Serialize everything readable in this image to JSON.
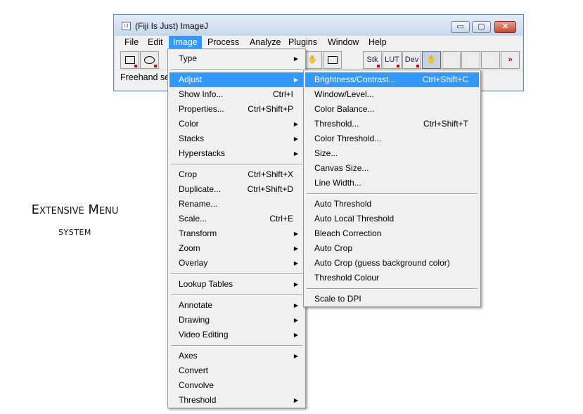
{
  "caption": {
    "line1": "Extensive Menu",
    "line2": "system"
  },
  "window": {
    "title": "(Fiji Is Just) ImageJ",
    "icon_text": "IJ",
    "controls": {
      "minimize": "▭",
      "maximize": "▢",
      "close": "✕"
    }
  },
  "menubar": [
    "File",
    "Edit",
    "Image",
    "Process",
    "Analyze",
    "Plugins",
    "Window",
    "Help"
  ],
  "toolbar": {
    "stk": "Stk",
    "lut": "LUT",
    "dev": "Dev",
    "more": "»",
    "hand": "✋"
  },
  "status": "Freehand selections",
  "image_menu": [
    {
      "label": "Type",
      "submenu": true
    },
    {
      "label": "Adjust",
      "submenu": true
    },
    {
      "label": "Show Info...",
      "shortcut": "Ctrl+I"
    },
    {
      "label": "Properties...",
      "shortcut": "Ctrl+Shift+P"
    },
    {
      "label": "Color",
      "submenu": true
    },
    {
      "label": "Stacks",
      "submenu": true
    },
    {
      "label": "Hyperstacks",
      "submenu": true
    },
    {
      "label": "Crop",
      "shortcut": "Ctrl+Shift+X"
    },
    {
      "label": "Duplicate...",
      "shortcut": "Ctrl+Shift+D"
    },
    {
      "label": "Rename..."
    },
    {
      "label": "Scale...",
      "shortcut": "Ctrl+E"
    },
    {
      "label": "Transform",
      "submenu": true
    },
    {
      "label": "Zoom",
      "submenu": true
    },
    {
      "label": "Overlay",
      "submenu": true
    },
    {
      "label": "Lookup Tables",
      "submenu": true
    },
    {
      "label": "Annotate",
      "submenu": true
    },
    {
      "label": "Drawing",
      "submenu": true
    },
    {
      "label": "Video Editing",
      "submenu": true
    },
    {
      "label": "Axes",
      "submenu": true
    },
    {
      "label": "Convert"
    },
    {
      "label": "Convolve"
    },
    {
      "label": "Threshold",
      "submenu": true
    }
  ],
  "adjust_menu": [
    {
      "label": "Brightness/Contrast...",
      "shortcut": "Ctrl+Shift+C"
    },
    {
      "label": "Window/Level..."
    },
    {
      "label": "Color Balance..."
    },
    {
      "label": "Threshold...",
      "shortcut": "Ctrl+Shift+T"
    },
    {
      "label": "Color Threshold..."
    },
    {
      "label": "Size..."
    },
    {
      "label": "Canvas Size..."
    },
    {
      "label": "Line Width..."
    },
    {
      "label": "Auto Threshold"
    },
    {
      "label": "Auto Local Threshold"
    },
    {
      "label": "Bleach Correction"
    },
    {
      "label": "Auto Crop"
    },
    {
      "label": "Auto Crop (guess background color)"
    },
    {
      "label": "Threshold Colour"
    },
    {
      "label": "Scale to DPI"
    }
  ],
  "arrow_glyph": "▶",
  "colors": {
    "highlight": "#3399ff",
    "menu_bg": "#f0f0f0"
  }
}
